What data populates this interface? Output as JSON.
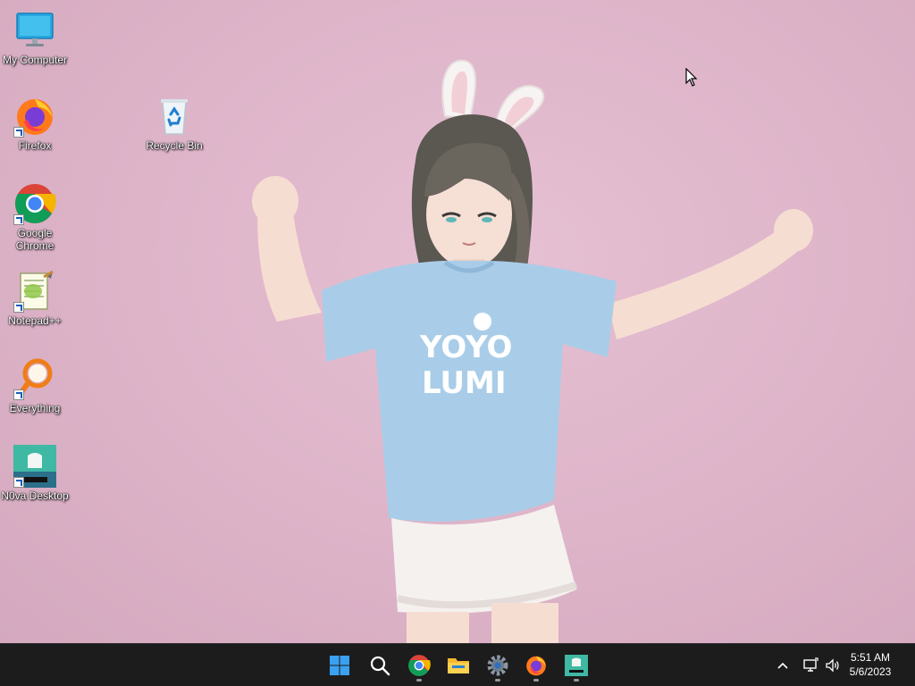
{
  "desktop": {
    "icons": [
      {
        "label": "My Computer"
      },
      {
        "label": "Firefox"
      },
      {
        "label": "Recycle Bin"
      },
      {
        "label": "Google Chrome"
      },
      {
        "label": "Notepad++"
      },
      {
        "label": "Everything"
      },
      {
        "label": "N0va Desktop"
      }
    ],
    "wallpaper": {
      "shirt_text_line1": "YOYO",
      "shirt_text_line2": "LUMI"
    }
  },
  "taskbar": {
    "apps": [
      {
        "name": "start",
        "running": false
      },
      {
        "name": "search",
        "running": false
      },
      {
        "name": "chrome",
        "running": true
      },
      {
        "name": "file-explorer",
        "running": false
      },
      {
        "name": "settings",
        "running": true
      },
      {
        "name": "firefox",
        "running": true
      },
      {
        "name": "n0va-desktop",
        "running": true
      }
    ],
    "clock": {
      "time": "5:51 AM",
      "date": "5/6/2023"
    }
  },
  "colors": {
    "wallpaper": "#dcb2c7",
    "taskbar": "#1c1c1c",
    "accent": "#0078d4"
  }
}
